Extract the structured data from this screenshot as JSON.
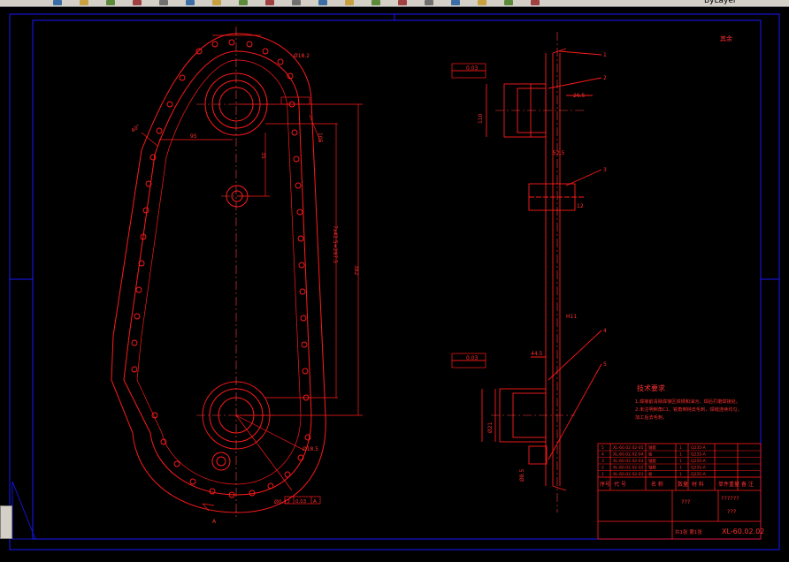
{
  "app": {
    "toolbar_label": "ByLayer",
    "icons": [
      "new-icon",
      "open-icon",
      "save-icon",
      "print-icon",
      "cut-icon",
      "copy-icon",
      "paste-icon",
      "undo-icon",
      "redo-icon",
      "pan-icon",
      "zoom-icon",
      "zoom-window-icon",
      "zoom-previous-icon",
      "text-icon",
      "properties-icon",
      "layer-icon",
      "calculator-icon",
      "match-icon",
      "help-icon"
    ]
  },
  "colors": {
    "frame": "#1818ff",
    "drawing": "#ff1a1a",
    "text_red": "#ff3030",
    "center": "#ff4040",
    "white": "#ffffff",
    "grey": "#d4d0c8"
  },
  "drawing": {
    "dims": {
      "d1": "40°",
      "d2": "Ø18.2",
      "d3": "105",
      "d4": "95",
      "d5": "35",
      "d6": "7x42.5=297.5",
      "d7": "382",
      "d8": "Ø18.2",
      "d9": "Ø18.5",
      "d10": "Ø0.12",
      "tol1": "0.03",
      "tol2": "0.03",
      "ref_a": "A",
      "side_1": "1",
      "side_2": "2",
      "side_3": "3",
      "side_4": "4",
      "side_5": "5",
      "sv_a": "26.5",
      "sv_b": "52.5",
      "sv_c": "44.5",
      "sv_d": "12",
      "sv_e": "110",
      "sv_f": "H11",
      "sv_g": "Ø21",
      "sv_h": "Ø8.5"
    },
    "roughness": "其余",
    "tech_title": "技术要求",
    "tech_lines": [
      "1.焊接前清除焊接区铁锈和油污，焊后打磨焊接处。",
      "2.未注明倒角C1，锐角倒钝去毛刺，焊缝连续均匀。",
      "加工后去毛刺。"
    ],
    "section_mark": "A"
  },
  "title_block": {
    "parts": [
      {
        "no": "5",
        "code": "XL-60.02.02-05",
        "name": "轴套",
        "qty": "1",
        "mat": "Q235-A"
      },
      {
        "no": "4",
        "code": "XL-60.02.02-04",
        "name": "板",
        "qty": "1",
        "mat": "Q235-A"
      },
      {
        "no": "3",
        "code": "XL-60.02.02-03",
        "name": "轴套",
        "qty": "1",
        "mat": "Q235-A"
      },
      {
        "no": "2",
        "code": "XL-60.02.02-02",
        "name": "轴套",
        "qty": "1",
        "mat": "Q235-A"
      },
      {
        "no": "1",
        "code": "XL-60.02.02-01",
        "name": "板",
        "qty": "1",
        "mat": "Q235-A"
      }
    ],
    "headers": [
      "序号",
      "代 号",
      "名 称",
      "数量",
      "材 料",
      "单件重量",
      "备 注"
    ],
    "unknown1": "???",
    "unknown2": "??????",
    "unknown3": "???",
    "sheet": "共1张 第1张",
    "drawing_no": "XL-60.02.02"
  }
}
